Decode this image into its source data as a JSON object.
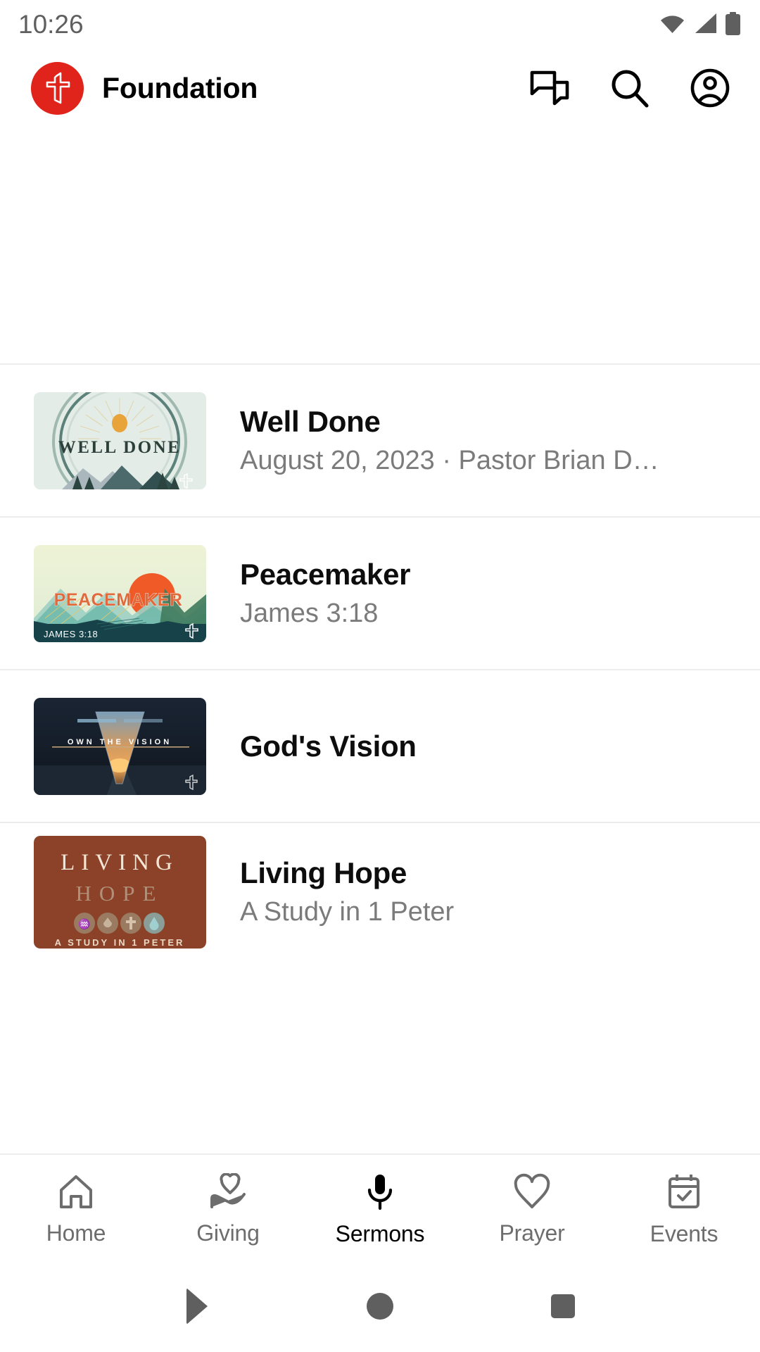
{
  "status_bar": {
    "time": "10:26",
    "icons": [
      "wifi-icon",
      "cellular-signal-icon",
      "battery-icon"
    ]
  },
  "app_bar": {
    "logo_icon": "church-cross-logo",
    "logo_color": "#e0241b",
    "title": "Foundation",
    "actions": [
      {
        "name": "messages-icon",
        "label": "Messages"
      },
      {
        "name": "search-icon",
        "label": "Search"
      },
      {
        "name": "account-icon",
        "label": "Account"
      }
    ]
  },
  "sermons": [
    {
      "title": "Well Done",
      "subtitle": "August 20, 2023 · Pastor Brian D…",
      "thumbnail": {
        "name": "well-done-thumbnail",
        "overlay_text": "WELL DONE",
        "caption": "",
        "bg": "#e3ece7",
        "accent": "#e8a33a"
      }
    },
    {
      "title": "Peacemaker",
      "subtitle": "James 3:18",
      "thumbnail": {
        "name": "peacemaker-thumbnail",
        "overlay_text": "PEACEMAKER",
        "caption": "JAMES 3:18",
        "bg": "#e8eecd",
        "accent": "#ef5a27"
      }
    },
    {
      "title": "God's Vision",
      "subtitle": "",
      "thumbnail": {
        "name": "gods-vision-thumbnail",
        "overlay_text": "V",
        "caption": "OWN THE VISION",
        "bg": "#1b2330",
        "accent": "#e8a15a"
      }
    },
    {
      "title": "Living Hope",
      "subtitle": "A Study in 1 Peter",
      "thumbnail": {
        "name": "living-hope-thumbnail",
        "overlay_text": "LIVING",
        "caption": "HOPE",
        "footer": "A STUDY IN 1 PETER",
        "bg": "#8b4229",
        "accent": "#f0e5d4"
      }
    }
  ],
  "bottom_nav": {
    "items": [
      {
        "label": "Home",
        "icon": "home-icon",
        "active": false
      },
      {
        "label": "Giving",
        "icon": "giving-icon",
        "active": false
      },
      {
        "label": "Sermons",
        "icon": "microphone-icon",
        "active": true
      },
      {
        "label": "Prayer",
        "icon": "heart-icon",
        "active": false
      },
      {
        "label": "Events",
        "icon": "calendar-check-icon",
        "active": false
      }
    ],
    "active_color": "#000000",
    "inactive_color": "#6d6d6d"
  },
  "system_nav": {
    "back": "back-button",
    "home": "home-button",
    "recents": "recents-button"
  }
}
